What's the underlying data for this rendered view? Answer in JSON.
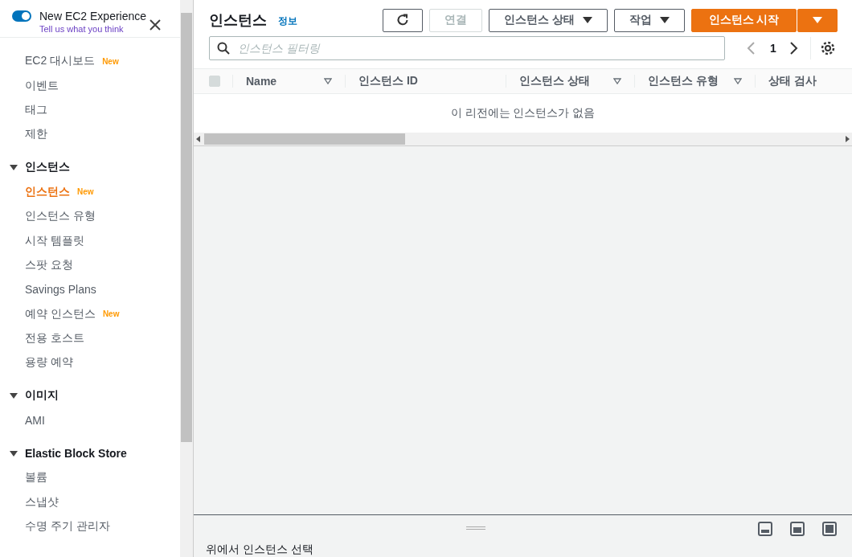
{
  "experience": {
    "toggle_on": true,
    "title": "New EC2 Experience",
    "link": "Tell us what you think"
  },
  "sidebar": {
    "groups": [
      {
        "items": [
          {
            "label": "EC2 대시보드",
            "badge": "New",
            "selected": false
          },
          {
            "label": "이벤트",
            "selected": false
          },
          {
            "label": "태그",
            "selected": false
          },
          {
            "label": "제한",
            "selected": false
          }
        ]
      },
      {
        "title": "인스턴스",
        "expanded": true,
        "items": [
          {
            "label": "인스턴스",
            "badge": "New",
            "selected": true
          },
          {
            "label": "인스턴스 유형",
            "selected": false
          },
          {
            "label": "시작 템플릿",
            "selected": false
          },
          {
            "label": "스팟 요청",
            "selected": false
          },
          {
            "label": "Savings Plans",
            "selected": false
          },
          {
            "label": "예약 인스턴스",
            "badge": "New",
            "selected": false
          },
          {
            "label": "전용 호스트",
            "selected": false
          },
          {
            "label": "용량 예약",
            "selected": false
          }
        ]
      },
      {
        "title": "이미지",
        "expanded": true,
        "items": [
          {
            "label": "AMI",
            "selected": false
          }
        ]
      },
      {
        "title": "Elastic Block Store",
        "expanded": true,
        "items": [
          {
            "label": "볼륨",
            "selected": false
          },
          {
            "label": "스냅샷",
            "selected": false
          },
          {
            "label": "수명 주기 관리자",
            "selected": false
          }
        ]
      }
    ]
  },
  "header": {
    "title": "인스턴스",
    "info": "정보",
    "buttons": [
      {
        "kind": "refresh"
      },
      {
        "kind": "normal",
        "label": "연결",
        "disabled": true
      },
      {
        "kind": "dropdown",
        "label": "인스턴스 상태"
      },
      {
        "kind": "dropdown",
        "label": "작업"
      },
      {
        "kind": "primary",
        "label": "인스턴스 시작"
      },
      {
        "kind": "primary-caret"
      }
    ]
  },
  "filter": {
    "placeholder": "인스턴스 필터링"
  },
  "pagination": {
    "page": "1"
  },
  "table": {
    "select_all_checked": false,
    "columns": [
      {
        "kind": "sortable",
        "label": "Name"
      },
      {
        "kind": "plain",
        "label": "인스턴스 ID"
      },
      {
        "kind": "sortable",
        "label": "인스턴스 상태"
      },
      {
        "kind": "sortable",
        "label": "인스턴스 유형"
      },
      {
        "kind": "plain",
        "label": "상태 검사"
      }
    ],
    "empty_message": "이 리전에는 인스턴스가 없음"
  },
  "detail_panel": {
    "message": "위에서 인스턴스 선택"
  }
}
